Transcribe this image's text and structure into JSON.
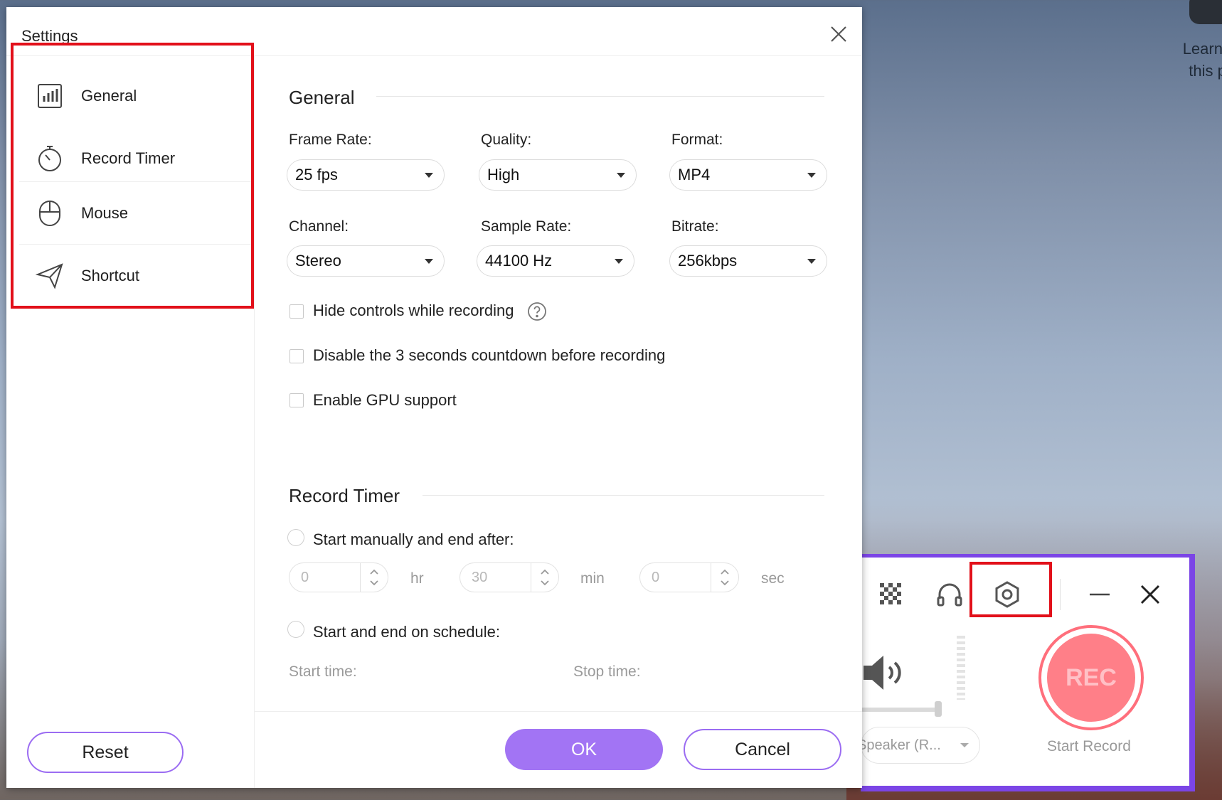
{
  "background": {
    "text": "Learn a\nthis pi"
  },
  "dialog": {
    "title": "Settings",
    "nav": [
      {
        "label": "General",
        "icon": "bar-chart-icon"
      },
      {
        "label": "Record Timer",
        "icon": "stopwatch-icon"
      },
      {
        "label": "Mouse",
        "icon": "mouse-icon"
      },
      {
        "label": "Shortcut",
        "icon": "paper-plane-icon"
      }
    ],
    "general": {
      "title": "General",
      "frame_rate": {
        "label": "Frame Rate:",
        "value": "25 fps"
      },
      "quality": {
        "label": "Quality:",
        "value": "High"
      },
      "format": {
        "label": "Format:",
        "value": "MP4"
      },
      "channel": {
        "label": "Channel:",
        "value": "Stereo"
      },
      "sample_rate": {
        "label": "Sample Rate:",
        "value": "44100 Hz"
      },
      "bitrate": {
        "label": "Bitrate:",
        "value": "256kbps"
      },
      "checkboxes": [
        {
          "label": "Hide controls while recording",
          "checked": false
        },
        {
          "label": "Disable the 3 seconds countdown before recording",
          "checked": false
        },
        {
          "label": "Enable GPU support",
          "checked": false
        }
      ]
    },
    "record_timer": {
      "title": "Record Timer",
      "option_manual": "Start manually and end after:",
      "hr": {
        "value": "0",
        "unit": "hr"
      },
      "min": {
        "value": "30",
        "unit": "min"
      },
      "sec": {
        "value": "0",
        "unit": "sec"
      },
      "option_schedule": "Start and end on schedule:",
      "start_time_label": "Start time:",
      "stop_time_label": "Stop time:"
    },
    "buttons": {
      "reset": "Reset",
      "ok": "OK",
      "cancel": "Cancel"
    }
  },
  "recorder": {
    "speaker": "Speaker (R...",
    "rec_label": "REC",
    "start_record": "Start Record"
  },
  "colors": {
    "accent": "#a274f4",
    "highlight_red": "#e2101a",
    "rec_red": "#ff7f88",
    "panel_border": "#7b45e6"
  }
}
